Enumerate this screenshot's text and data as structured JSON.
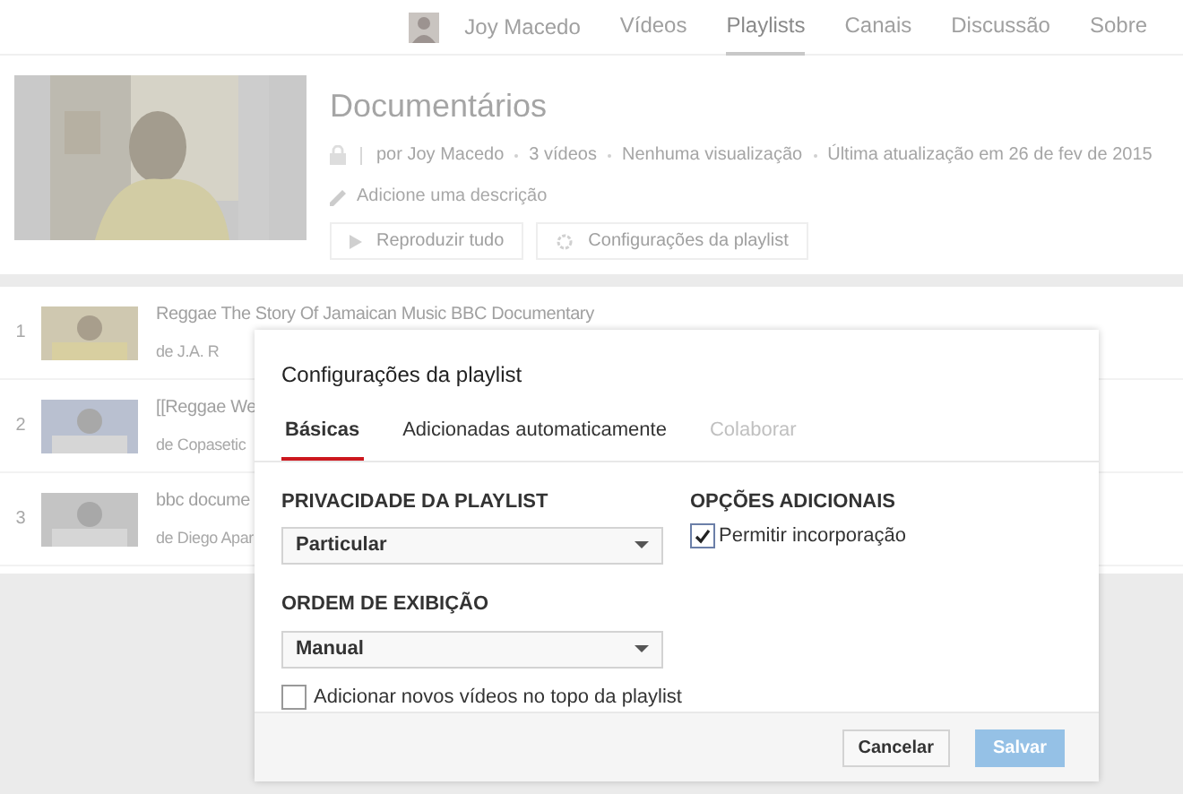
{
  "nav": {
    "channel": "Joy Macedo",
    "tabs": [
      {
        "label": "Vídeos",
        "selected": false
      },
      {
        "label": "Playlists",
        "selected": true
      },
      {
        "label": "Canais",
        "selected": false
      },
      {
        "label": "Discussão",
        "selected": false
      },
      {
        "label": "Sobre",
        "selected": false
      }
    ]
  },
  "playlist": {
    "title": "Documentários",
    "meta": [
      "por Joy Macedo",
      "3 vídeos",
      "Nenhuma visualização",
      "Última atualização em 26 de fev de 2015"
    ],
    "description_placeholder": "Adicione uma descrição",
    "buttons": [
      "Reproduzir tudo",
      "Configurações da playlist"
    ]
  },
  "videos": [
    {
      "index": "1",
      "title": "Reggae The Story Of Jamaican Music BBC Documentary",
      "channel": "de J.A. R"
    },
    {
      "index": "2",
      "title": "[[Reggae We",
      "channel": "de Copasetic"
    },
    {
      "index": "3",
      "title": "bbc docume",
      "channel": "de Diego Apar"
    }
  ],
  "dialog": {
    "title": "Configurações da playlist",
    "tabs": [
      {
        "label": "Básicas",
        "selected": true,
        "disabled": false
      },
      {
        "label": "Adicionadas automaticamente",
        "selected": false,
        "disabled": false
      },
      {
        "label": "Colaborar",
        "selected": false,
        "disabled": true
      }
    ],
    "privacy": {
      "label": "PRIVACIDADE DA PLAYLIST",
      "value": "Particular"
    },
    "order": {
      "label": "ORDEM DE EXIBIÇÃO",
      "value": "Manual"
    },
    "add_to_top": {
      "label": "Adicionar novos vídeos no topo da playlist",
      "checked": false
    },
    "extra": {
      "label": "OPÇÕES ADICIONAIS",
      "options": [
        {
          "label": "Permitir incorporação",
          "checked": true
        }
      ]
    },
    "buttons": {
      "cancel": "Cancelar",
      "save": "Salvar"
    }
  }
}
